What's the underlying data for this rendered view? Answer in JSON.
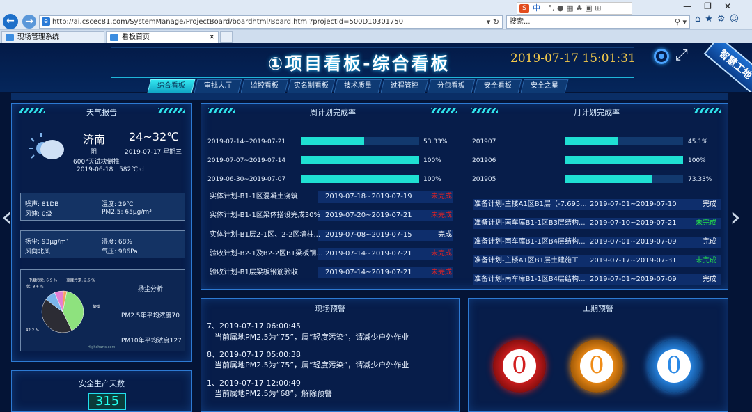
{
  "browser": {
    "url": "http://ai.cscec81.com/SystemManage/ProjectBoard/boardhtml/Board.html?projectid=500D10301750",
    "search_placeholder": "搜索...",
    "ime_label": "中",
    "tabs": [
      {
        "label": "现场管理系统"
      },
      {
        "label": "看板首页"
      }
    ],
    "tool_icons": [
      "home-icon",
      "star-icon",
      "gear-icon",
      "smiley-icon"
    ]
  },
  "header": {
    "title": "①项目看板-综合看板",
    "clock": "2019-07-17 15:01:31",
    "ribbon": "智慧工地"
  },
  "nav_tabs": [
    "综合看板",
    "审批大厅",
    "监控看板",
    "实名制看板",
    "技术质量",
    "过程管控",
    "分包看板",
    "安全看板",
    "安全之星"
  ],
  "weather": {
    "title": "天气报告",
    "city": "济南",
    "temp": "24~32℃",
    "condition": "阴",
    "date": "2019-07-17 星期三",
    "note": "600°天试块倒推",
    "note_date": "2019-06-18",
    "note_value": "582℃·d",
    "noise_label": "噪声: 81DB",
    "temp_label": "温度: 29℃",
    "wind_label": "风速: 0级",
    "pm25_label": "PM2.5: 65μg/m³",
    "dust_label": "扬尘: 93μg/m³",
    "humidity_label": "湿度: 68%",
    "winddir_label": "风向北风",
    "pressure_label": "气压: 986Pa"
  },
  "dust": {
    "title": "扬尘分析",
    "pm25_avg": "PM2.5年平均浓度70",
    "pm10_avg": "PM10年平均浓度127",
    "credit": "Highcharts.com",
    "slices": [
      {
        "label": "轻度污染:",
        "pct": "39.7 %",
        "value": 39.7,
        "color": "#8ee27e"
      },
      {
        "label": "良:",
        "pct": "42.2 %",
        "value": 42.2,
        "color": "#2c2c34"
      },
      {
        "label": "优:",
        "pct": "8.6 %",
        "value": 8.6,
        "color": "#7ab5ea"
      },
      {
        "label": "中度污染:",
        "pct": "6.9 %",
        "value": 6.9,
        "color": "#e57fd2"
      },
      {
        "label": "重度污染:",
        "pct": "2.6 %",
        "value": 2.6,
        "color": "#f4a160"
      }
    ]
  },
  "safety": {
    "title": "安全生产天数",
    "value": "315"
  },
  "weekly": {
    "title": "周计划完成率",
    "bars": [
      {
        "label": "2019-07-14~2019-07-21",
        "value": 53.33,
        "text": "53.33%"
      },
      {
        "label": "2019-07-07~2019-07-14",
        "value": 100,
        "text": "100%"
      },
      {
        "label": "2019-06-30~2019-07-07",
        "value": 100,
        "text": "100%"
      }
    ],
    "rows": [
      {
        "name": "实体计划-B1-1区混凝土浇筑",
        "dates": "2019-07-18~2019-07-19",
        "status": "未完成",
        "cls": "red"
      },
      {
        "name": "实体计划-B1-1区梁体搭设完成30%",
        "dates": "2019-07-20~2019-07-21",
        "status": "未完成",
        "cls": "red"
      },
      {
        "name": "实体计划-B1层2-1区、2-2区墙柱...",
        "dates": "2019-07-08~2019-07-15",
        "status": "完成",
        "cls": "white"
      },
      {
        "name": "验收计划-B2-1及B2-2区B1梁板钢...",
        "dates": "2019-07-14~2019-07-21",
        "status": "未完成",
        "cls": "red"
      },
      {
        "name": "验收计划-B1层梁板钢筋验收",
        "dates": "2019-07-14~2019-07-21",
        "status": "未完成",
        "cls": "red"
      }
    ]
  },
  "monthly": {
    "title": "月计划完成率",
    "bars": [
      {
        "label": "201907",
        "value": 45.1,
        "text": "45.1%"
      },
      {
        "label": "201906",
        "value": 100,
        "text": "100%"
      },
      {
        "label": "201905",
        "value": 73.33,
        "text": "73.33%"
      }
    ],
    "rows": [
      {
        "name": "准备计划-主楼A1区B1层（-7.695...",
        "dates": "2019-07-01~2019-07-10",
        "status": "完成",
        "cls": "white"
      },
      {
        "name": "准备计划-南车库B1-1区B3层结构...",
        "dates": "2019-07-10~2019-07-21",
        "status": "未完成",
        "cls": "green"
      },
      {
        "name": "准备计划-南车库B1-1区B4层结构...",
        "dates": "2019-07-01~2019-07-09",
        "status": "完成",
        "cls": "white"
      },
      {
        "name": "准备计划-主楼A1区B1层土建施工",
        "dates": "2019-07-17~2019-07-31",
        "status": "未完成",
        "cls": "green"
      },
      {
        "name": "准备计划-南车库B1-1区B4层结构...",
        "dates": "2019-07-01~2019-07-09",
        "status": "完成",
        "cls": "white"
      }
    ]
  },
  "site_alert": {
    "title": "现场预警",
    "items": [
      {
        "head": "7、2019-07-17 06:00:45",
        "body": "当前属地PM2.5为“75”，属“轻度污染”，请减少户外作业"
      },
      {
        "head": "8、2019-07-17 05:00:38",
        "body": "当前属地PM2.5为“75”，属“轻度污染”，请减少户外作业"
      },
      {
        "head": "1、2019-07-17 12:00:49",
        "body": "当前属地PM2.5为“68”，解除预警"
      }
    ]
  },
  "period_alert": {
    "title": "工期预警",
    "values": [
      "0",
      "0",
      "0"
    ],
    "colors": [
      "#d21e1e",
      "#f08c16",
      "#2a89e6"
    ]
  },
  "colors": {
    "accent": "#1fe0d3",
    "panel_border": "#2d7ad3",
    "clock": "#f3c94a"
  }
}
